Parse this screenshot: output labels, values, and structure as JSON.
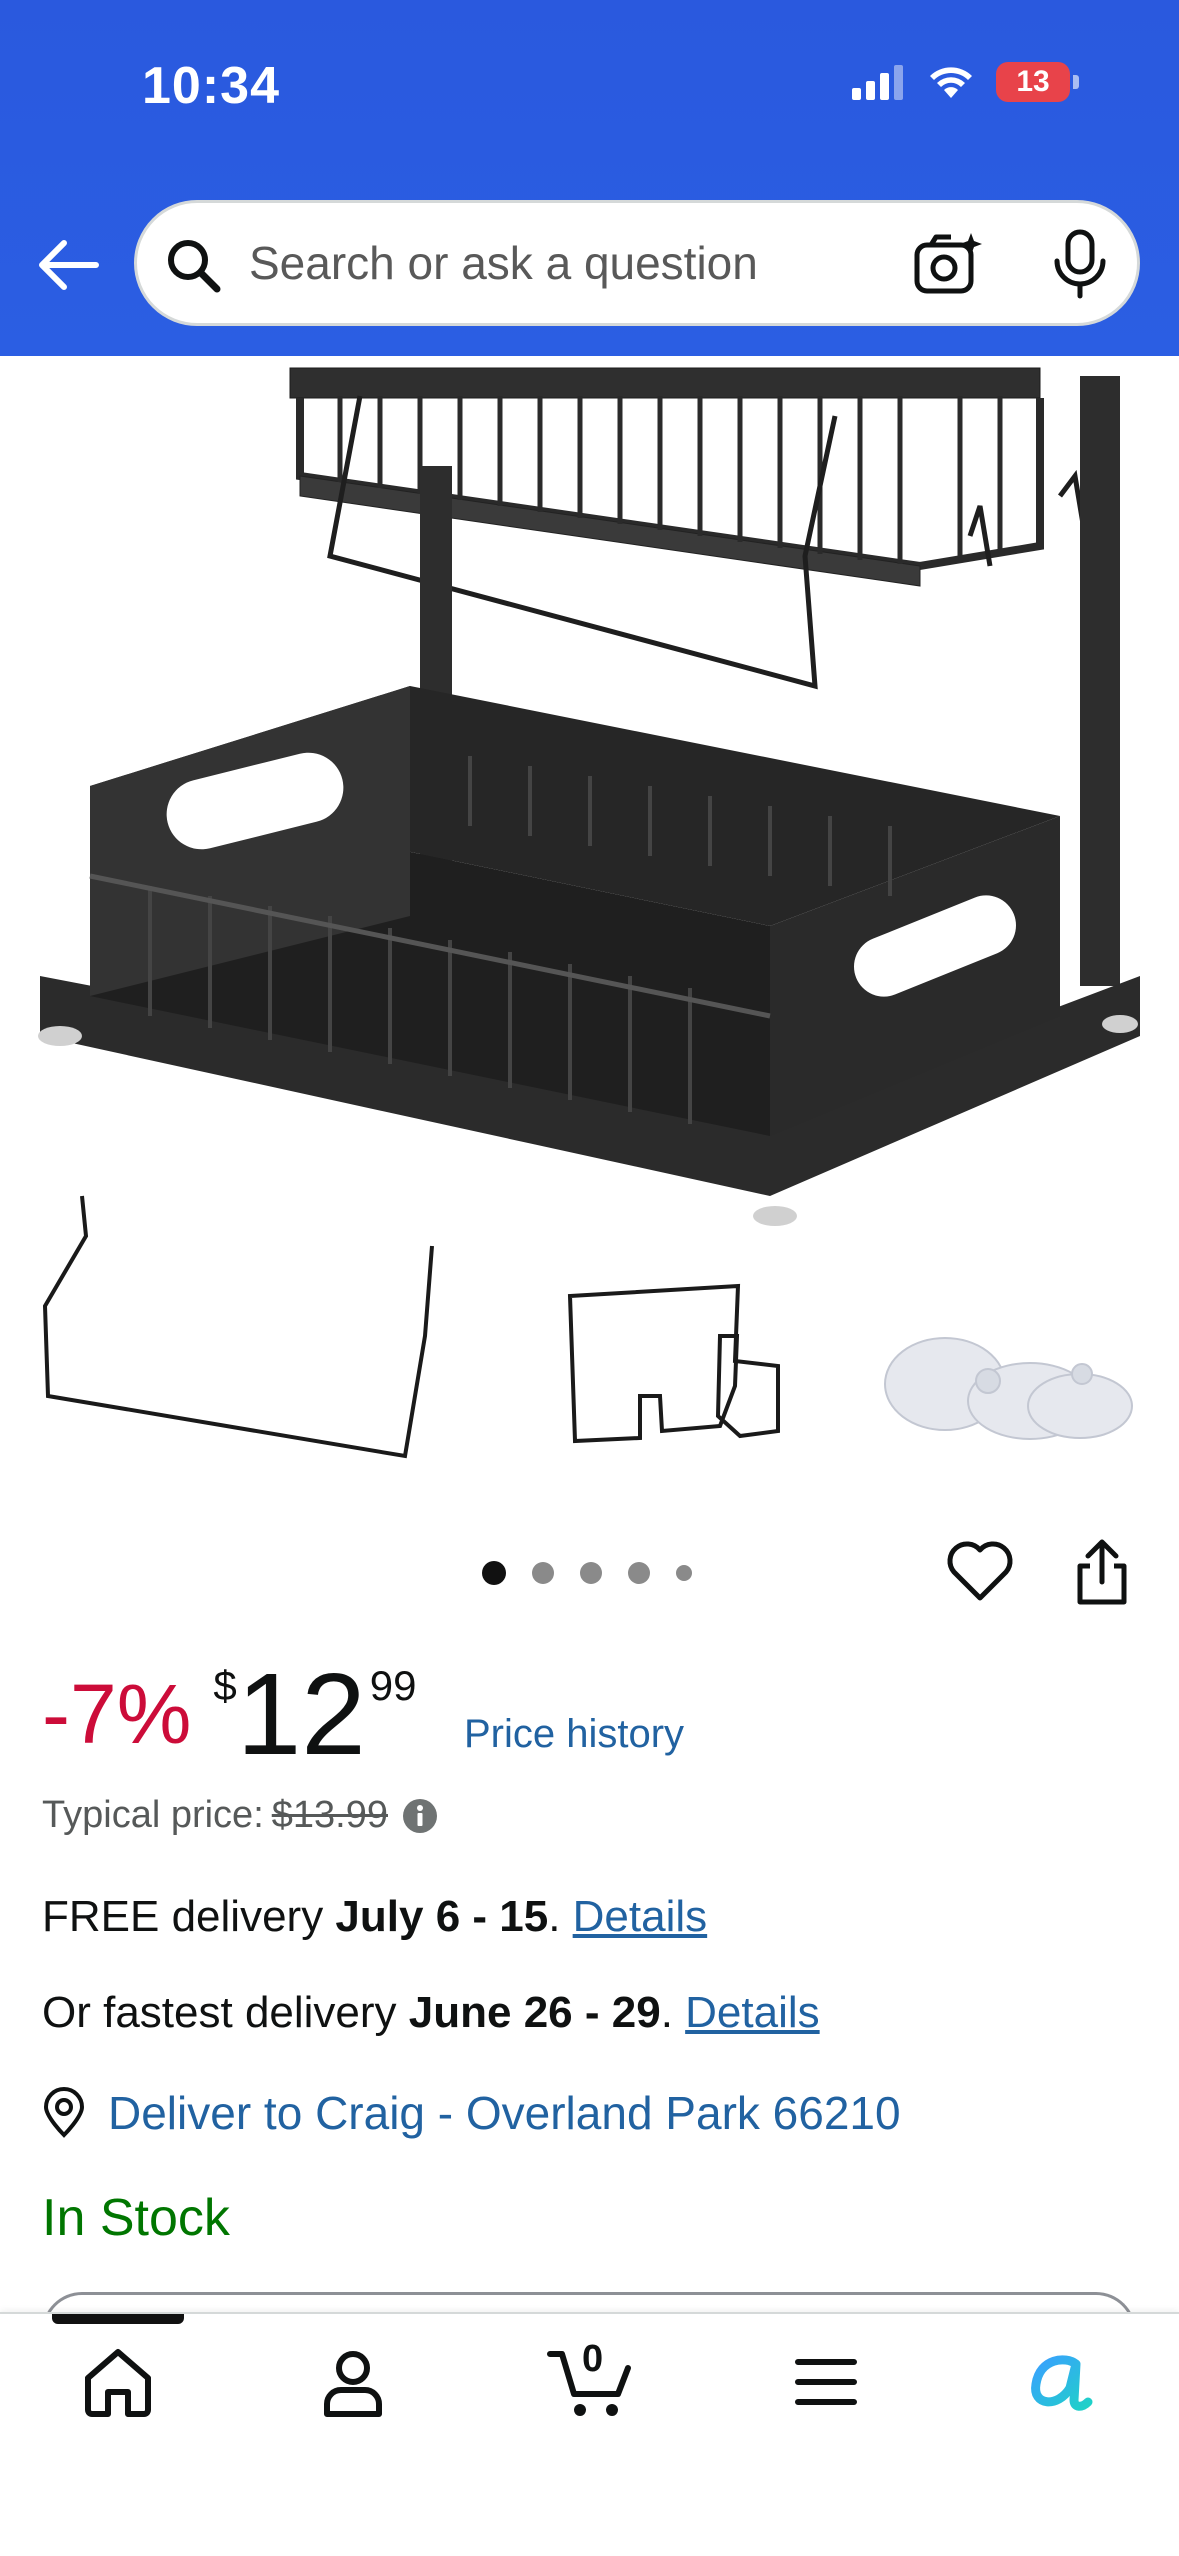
{
  "status_bar": {
    "time": "10:34",
    "battery": "13"
  },
  "search": {
    "placeholder": "Search or ask a question"
  },
  "icons": {
    "back": "arrow-left-icon",
    "search": "magnifier-icon",
    "camera": "camera-sparkle-icon",
    "mic": "microphone-icon",
    "heart": "heart-outline-icon",
    "share": "share-icon",
    "info": "info-icon",
    "location": "location-pin-icon",
    "home": "home-icon",
    "account": "person-icon",
    "cart": "cart-icon",
    "menu": "hamburger-menu-icon",
    "rufus": "rufus-ai-icon"
  },
  "carousel": {
    "total_dots": 5,
    "active_index": 0
  },
  "price": {
    "discount": "-7%",
    "currency": "$",
    "dollars": "12",
    "cents": "99",
    "history_link": "Price history",
    "typical_label": "Typical price:",
    "typical_value": "$13.99"
  },
  "delivery": {
    "free_prefix": "FREE delivery ",
    "free_dates": "July 6 - 15",
    "free_suffix": ". ",
    "free_details": "Details",
    "fast_prefix": "Or fastest delivery ",
    "fast_dates": "June 26 - 29",
    "fast_suffix": ". ",
    "fast_details": "Details",
    "deliver_to": "Deliver to Craig - Overland Park 66210"
  },
  "stock": {
    "status": "In Stock"
  },
  "bottom_nav": {
    "cart_count": "0"
  },
  "colors": {
    "header_blue": "#2b5ee3",
    "discount_red": "#cc0c39",
    "link_blue": "#2162a1",
    "stock_green": "#007600"
  }
}
